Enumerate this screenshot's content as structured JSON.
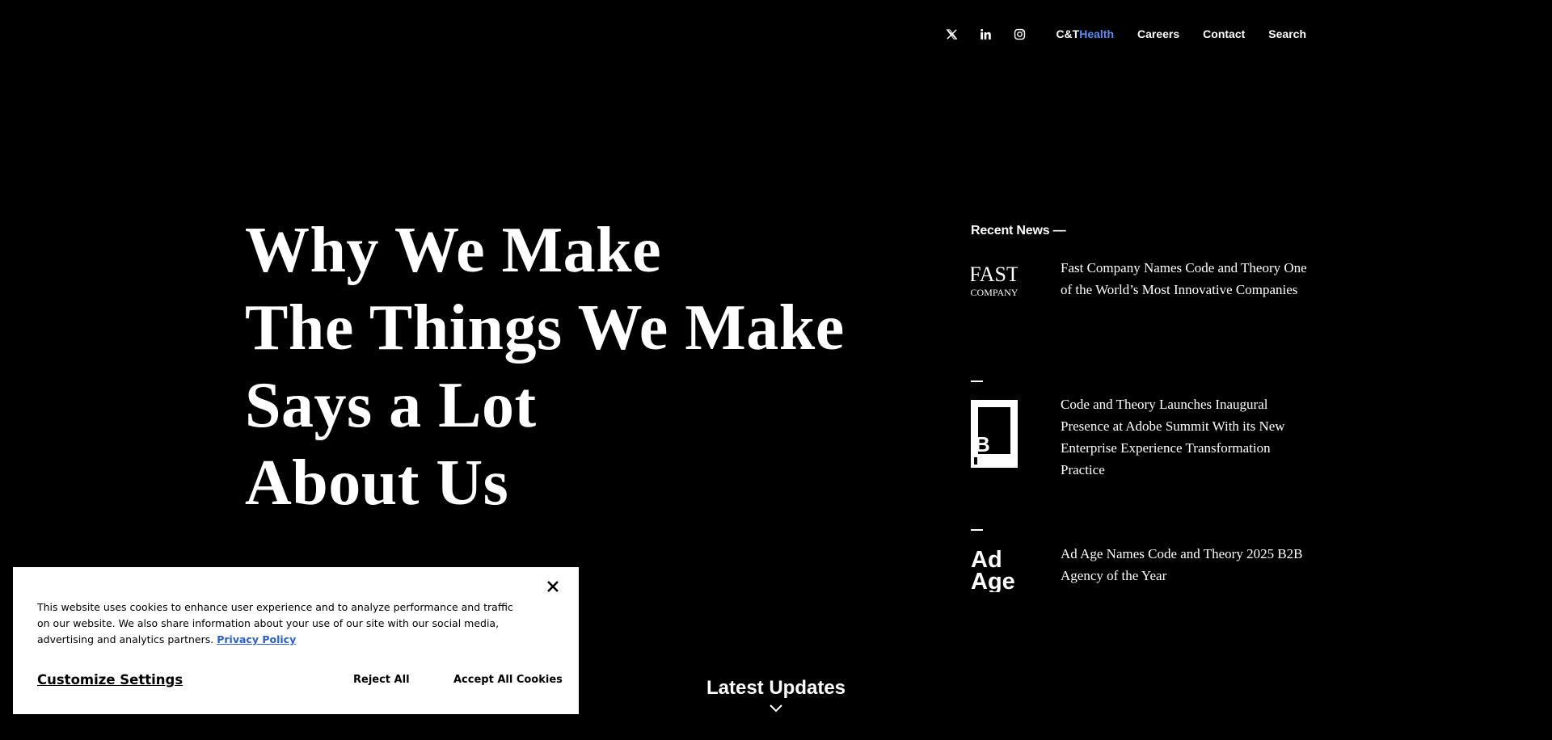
{
  "nav": {
    "social": [
      {
        "icon": "x-twitter-icon"
      },
      {
        "icon": "linkedin-icon"
      },
      {
        "icon": "instagram-icon"
      }
    ],
    "brand_prefix": "C&T",
    "brand_suffix": "Health",
    "careers": "Careers",
    "contact": "Contact",
    "search": "Search"
  },
  "hero": {
    "lines": [
      "Why We Make",
      "The Things We Make",
      "Says a Lot",
      "About Us"
    ]
  },
  "news": {
    "heading": "Recent News —",
    "items": [
      {
        "logo": "fast-company-logo",
        "logo_text_top": "FAST",
        "logo_text_bottom": "COMPANY",
        "text": "Fast Company Names Code and Theory One of the World’s Most Innovative Companies"
      },
      {
        "logo": "business-insider-logo",
        "logo_text": "B",
        "text": "Code and Theory Launches Inaugural Presence at Adobe Summit With its New Enterprise Experience Transformation Practice"
      },
      {
        "logo": "ad-age-logo",
        "logo_text_top": "Ad",
        "logo_text_bottom": "Age",
        "text": "Ad Age Names Code and Theory 2025 B2B Agency of the Year"
      }
    ]
  },
  "latest": {
    "label": "Latest Updates"
  },
  "cookie": {
    "text": "This website uses cookies to enhance user experience and to analyze performance and traffic on our website. We also share information about your use of our site with our social media, advertising and analytics partners.",
    "privacy_link": "Privacy Policy",
    "customize": "Customize Settings",
    "reject": "Reject All",
    "accept": "Accept All Cookies"
  },
  "colors": {
    "background": "#000000",
    "text": "#ffffff",
    "brand_accent": "#5b8def",
    "link": "#2b5fc9"
  }
}
